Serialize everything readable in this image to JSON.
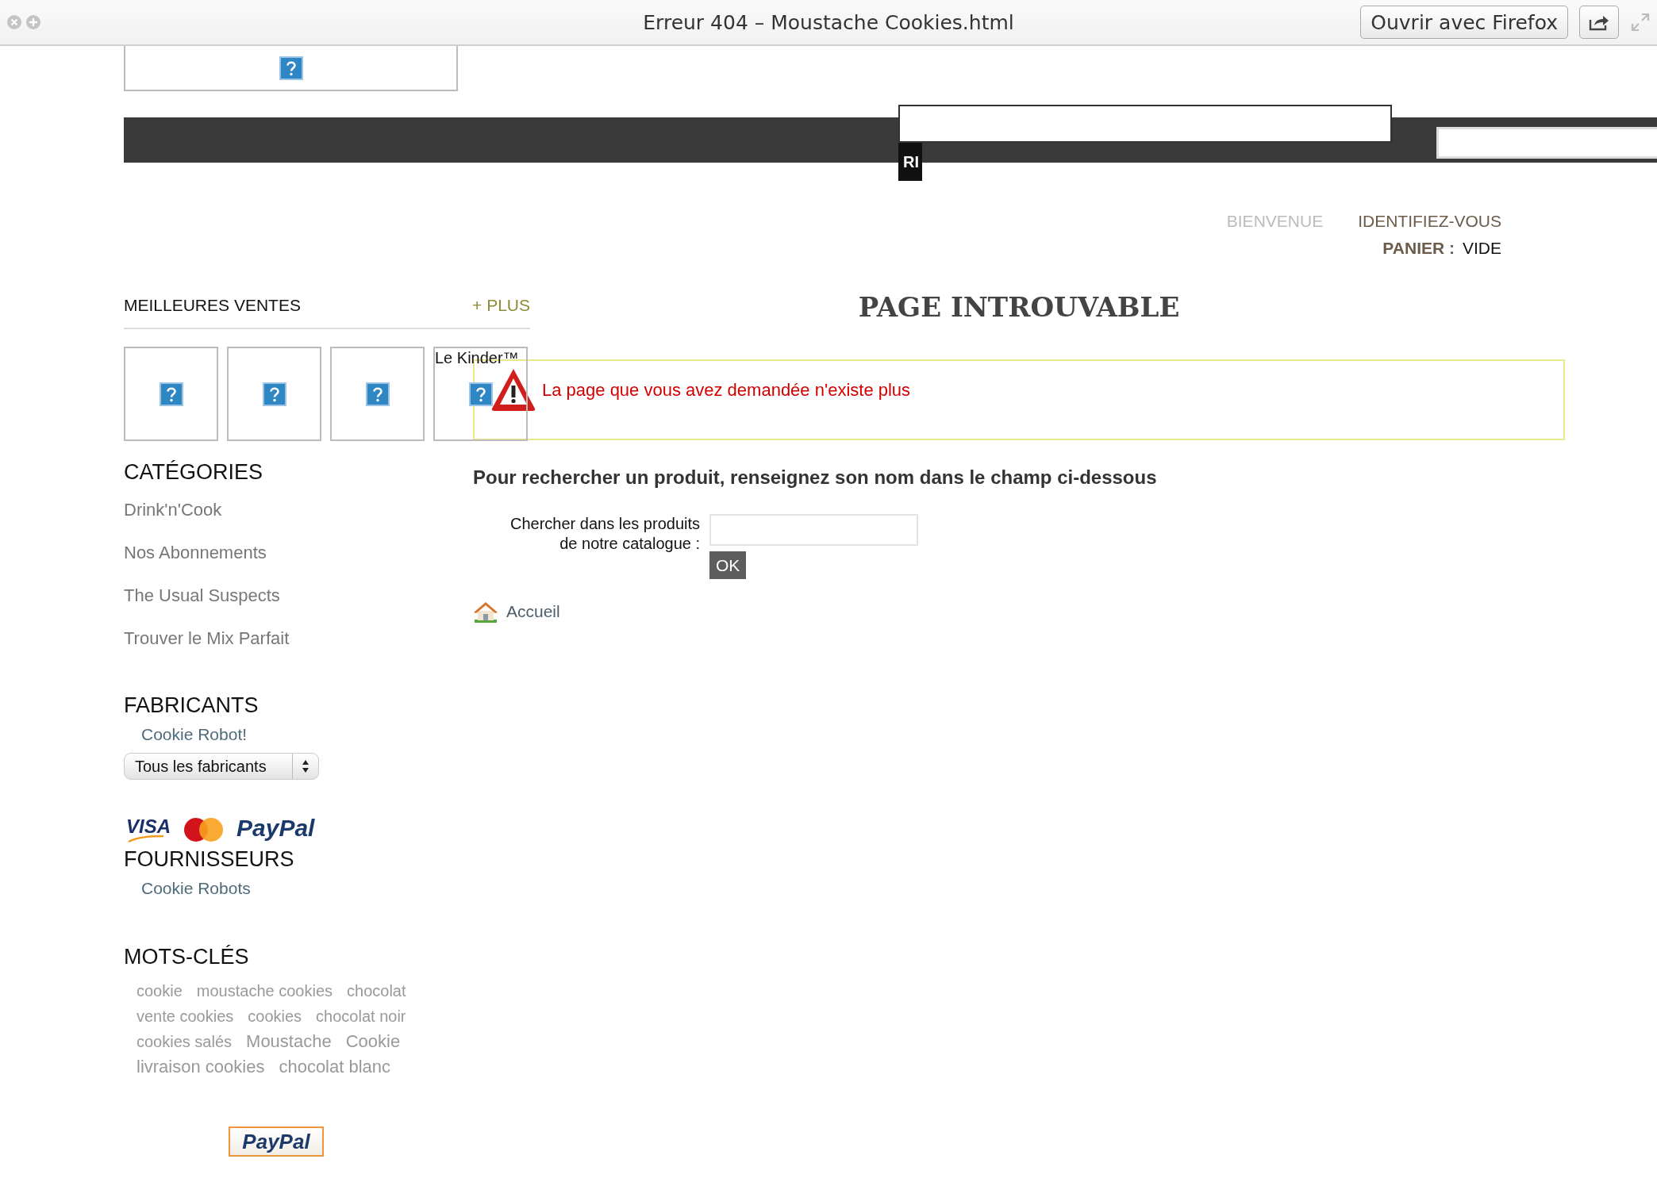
{
  "window": {
    "title": "Erreur 404 – Moustache Cookies.html",
    "open_button": "Ouvrir avec Firefox"
  },
  "header": {
    "search_button": "RI"
  },
  "user_nav": {
    "welcome": "BIENVENUE",
    "login": "IDENTIFIEZ-VOUS",
    "cart_label": "PANIER :",
    "cart_value": "VIDE"
  },
  "best_sellers": {
    "title": "MEILLEURES VENTES",
    "more": "+ PLUS",
    "products": [
      {
        "kind": "image"
      },
      {
        "kind": "image"
      },
      {
        "kind": "image"
      },
      {
        "kind": "titled",
        "name": "Le Kinder™"
      }
    ]
  },
  "categories": {
    "title": "CATÉGORIES",
    "items": [
      "Drink'n'Cook",
      "Nos Abonnements",
      "The Usual Suspects",
      "Trouver le Mix Parfait"
    ]
  },
  "manufacturers": {
    "title": "FABRICANTS",
    "items": [
      "Cookie Robot!"
    ],
    "select": "Tous les fabricants"
  },
  "payment_logos": {
    "visa": "VISA",
    "paypal": "PayPal"
  },
  "suppliers": {
    "title": "FOURNISSEURS",
    "items": [
      "Cookie Robots"
    ]
  },
  "tags": {
    "title": "MOTS-CLÉS",
    "items": [
      {
        "label": "cookie",
        "kind": "small"
      },
      {
        "label": "moustache cookies",
        "kind": "small"
      },
      {
        "label": "chocolat",
        "kind": "small"
      },
      {
        "label": "vente cookies",
        "kind": "small"
      },
      {
        "label": "cookies",
        "kind": "small"
      },
      {
        "label": "chocolat noir",
        "kind": "small"
      },
      {
        "label": "cookies salés",
        "kind": "small"
      },
      {
        "label": "Moustache",
        "kind": "large"
      },
      {
        "label": "Cookie",
        "kind": "large"
      },
      {
        "label": "livraison cookies",
        "kind": "large"
      },
      {
        "label": "chocolat blanc",
        "kind": "large"
      }
    ]
  },
  "paypal_badge": "PayPal",
  "error": {
    "title": "PAGE INTROUVABLE",
    "message": "La page que vous avez demandée n'existe plus"
  },
  "search": {
    "heading": "Pour rechercher un produit, renseignez son nom dans le champ ci-dessous",
    "label": "Chercher dans les produits de notre catalogue :",
    "button": "OK"
  },
  "home_link": "Accueil"
}
